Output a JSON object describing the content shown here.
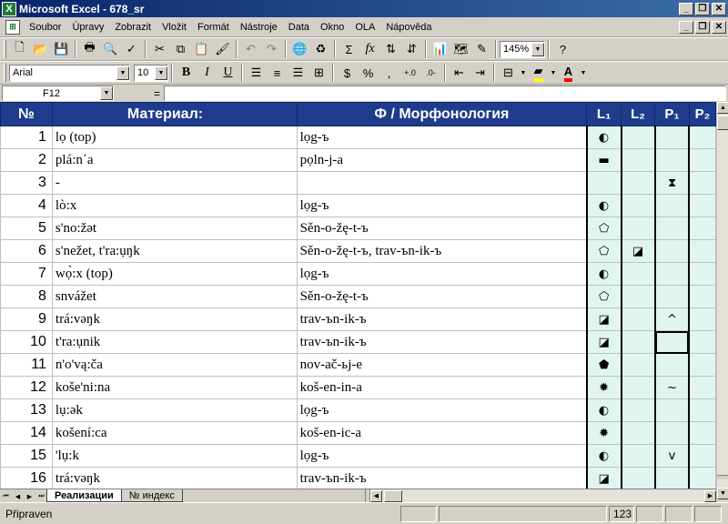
{
  "window": {
    "app_icon": "excel-icon",
    "title": "Microsoft Excel - 678_sr",
    "buttons": [
      "_",
      "❐",
      "✕"
    ],
    "doc_buttons": [
      "_",
      "❐",
      "✕"
    ]
  },
  "menu": [
    "Soubor",
    "Úpravy",
    "Zobrazit",
    "Vložit",
    "Formát",
    "Nástroje",
    "Data",
    "Okno",
    "OLA",
    "Nápověda"
  ],
  "toolbar": {
    "icons": [
      "new-icon",
      "open-icon",
      "save-icon",
      "print-icon",
      "preview-icon",
      "spell-icon",
      "cut-icon",
      "copy-icon",
      "paste-icon",
      "format-painter-icon",
      "undo-icon",
      "redo-icon",
      "hyperlink-icon",
      "web-icon",
      "autosum-icon",
      "function-icon",
      "sort-asc-icon",
      "sort-desc-icon",
      "chart-wizard-icon",
      "map-icon",
      "drawing-icon",
      "help-icon"
    ],
    "zoom": "145%"
  },
  "format_bar": {
    "font_name": "Arial",
    "font_size": "10",
    "bold": "B",
    "italic": "I",
    "underline": "U",
    "currency": "$",
    "percent": "%",
    "comma": ",",
    "inc_decimal": "+.0",
    "dec_decimal": ".0-",
    "fill_color": "#ffff00",
    "font_color": "#ff0000"
  },
  "formula_bar": {
    "name_box": "F12",
    "equals": "=",
    "content": ""
  },
  "sheet": {
    "headers": {
      "num": "№",
      "material": "Материал:",
      "phon": "Ф / Морфонология",
      "l1": "L₁",
      "l2": "L₂",
      "p1": "P₁",
      "p2": "P₂"
    },
    "header_color": "#1f3c8c",
    "mark_color": "#e0f5f0",
    "rows": [
      {
        "num": "1",
        "material": "lọ (top)",
        "phon": "lọg-ъ",
        "l1": "◐",
        "l2": "",
        "p1": "",
        "p2": ""
      },
      {
        "num": "2",
        "material": "plá:n´a",
        "phon": "pọln-j-a",
        "l1": "▬",
        "l2": "",
        "p1": "",
        "p2": ""
      },
      {
        "num": "3",
        "material": "-",
        "phon": "",
        "l1": "",
        "l2": "",
        "p1": "⧗",
        "p2": ""
      },
      {
        "num": "4",
        "material": "lò:x",
        "phon": "lọg-ъ",
        "l1": "◐",
        "l2": "",
        "p1": "",
        "p2": ""
      },
      {
        "num": "5",
        "material": "s'no:žət",
        "phon": "Sěn-o-žę-t-ъ",
        "l1": "⬠",
        "l2": "",
        "p1": "",
        "p2": ""
      },
      {
        "num": "6",
        "material": "s'nežet, t'ra:ụŋk",
        "phon": "Sěn-o-žę-t-ъ, trav-ъn-ik-ъ",
        "l1": "⬠",
        "l2": "◪",
        "p1": "",
        "p2": ""
      },
      {
        "num": "7",
        "material": "wọ̀:x (top)",
        "phon": "lọg-ъ",
        "l1": "◐",
        "l2": "",
        "p1": "",
        "p2": ""
      },
      {
        "num": "8",
        "material": "snvážet",
        "phon": "Sěn-o-žę-t-ъ",
        "l1": "⬠",
        "l2": "",
        "p1": "",
        "p2": ""
      },
      {
        "num": "9",
        "material": "trá:vəŋk",
        "phon": "trav-ъn-ik-ъ",
        "l1": "◪",
        "l2": "",
        "p1": "^",
        "p2": ""
      },
      {
        "num": "10",
        "material": "t'ra:ụnik",
        "phon": "trav-ъn-ik-ъ",
        "l1": "◪",
        "l2": "",
        "p1": "",
        "p2": ""
      },
      {
        "num": "11",
        "material": "n'o'vą:ča",
        "phon": "nov-ač-ьj-e",
        "l1": "⬟",
        "l2": "",
        "p1": "",
        "p2": ""
      },
      {
        "num": "12",
        "material": "koše'ni:na",
        "phon": "koš-en-in-a",
        "l1": "✹",
        "l2": "",
        "p1": "~",
        "p2": ""
      },
      {
        "num": "13",
        "material": "lụ:ək",
        "phon": "lọg-ъ",
        "l1": "◐",
        "l2": "",
        "p1": "",
        "p2": ""
      },
      {
        "num": "14",
        "material": "košení:ca",
        "phon": "koš-en-ic-a",
        "l1": "✹",
        "l2": "",
        "p1": "",
        "p2": ""
      },
      {
        "num": "15",
        "material": "'lụ:k",
        "phon": "lọg-ъ",
        "l1": "◐",
        "l2": "",
        "p1": "v",
        "p2": ""
      },
      {
        "num": "16",
        "material": "trá:vəŋk",
        "phon": "trav-ъn-ik-ъ",
        "l1": "◪",
        "l2": "",
        "p1": "",
        "p2": ""
      }
    ],
    "selected_cell": {
      "row": 9,
      "col": "p1"
    }
  },
  "tabs": {
    "nav": [
      "⏮",
      "◀",
      "▶",
      "⏭"
    ],
    "items": [
      {
        "label": "Реализации",
        "active": true
      },
      {
        "label": "№ индекс",
        "active": false
      }
    ]
  },
  "status": {
    "text": "Připraven",
    "count": "123"
  }
}
